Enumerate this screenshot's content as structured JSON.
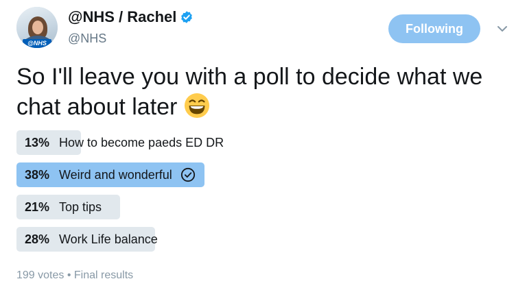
{
  "author": {
    "display_name": "@NHS / Rachel",
    "handle": "@NHS",
    "avatar_badge": "@NHS",
    "verified": true
  },
  "follow_button": {
    "label": "Following"
  },
  "tweet": {
    "text": "So I'll leave you with a poll to decide what we chat about later",
    "emoji": "grinning-face-icon"
  },
  "poll": {
    "options": [
      {
        "percent_label": "13%",
        "percent": 13,
        "label": "How to become paeds ED DR",
        "winner": false
      },
      {
        "percent_label": "38%",
        "percent": 38,
        "label": "Weird and wonderful",
        "winner": true
      },
      {
        "percent_label": "21%",
        "percent": 21,
        "label": "Top tips",
        "winner": false
      },
      {
        "percent_label": "28%",
        "percent": 28,
        "label": "Work Life balance",
        "winner": false
      }
    ],
    "votes": "199 votes",
    "separator": "•",
    "status": "Final results"
  },
  "colors": {
    "accent": "#1da1f2",
    "follow_bg": "#8ec3f2",
    "winner_bar": "#8ec3f2",
    "bar": "#e1e8ed",
    "secondary_text": "#657786"
  }
}
